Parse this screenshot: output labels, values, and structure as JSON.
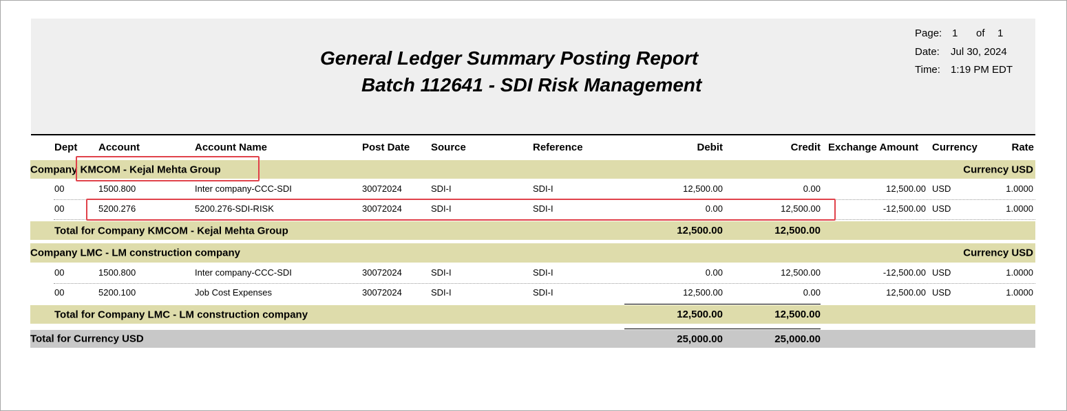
{
  "report": {
    "title": "General Ledger Summary Posting Report",
    "subtitle": "Batch 112641 - SDI Risk Management",
    "page_label": "Page:",
    "page_num": "1",
    "of_label": "of",
    "page_total": "1",
    "date_label": "Date:",
    "date_value": "Jul 30, 2024",
    "time_label": "Time:",
    "time_value": "1:19 PM EDT"
  },
  "columns": {
    "dept": "Dept",
    "account": "Account",
    "account_name": "Account Name",
    "post_date": "Post Date",
    "source": "Source",
    "reference": "Reference",
    "debit": "Debit",
    "credit": "Credit",
    "exchange_amount": "Exchange Amount",
    "currency": "Currency",
    "rate": "Rate"
  },
  "groups": [
    {
      "label": "Company KMCOM - Kejal Mehta Group",
      "currency_label": "Currency USD",
      "rows": [
        {
          "dept": "00",
          "account": "1500.800",
          "account_name": "Inter company-CCC-SDI",
          "post_date": "30072024",
          "source": "SDI-I",
          "reference": "SDI-I",
          "debit": "12,500.00",
          "credit": "0.00",
          "exchange_amount": "12,500.00",
          "currency": "USD",
          "rate": "1.0000"
        },
        {
          "dept": "00",
          "account": "5200.276",
          "account_name": "5200.276-SDI-RISK",
          "post_date": "30072024",
          "source": "SDI-I",
          "reference": "SDI-I",
          "debit": "0.00",
          "credit": "12,500.00",
          "exchange_amount": "-12,500.00",
          "currency": "USD",
          "rate": "1.0000"
        }
      ],
      "total_label": "Total for Company KMCOM - Kejal Mehta Group",
      "total_debit": "12,500.00",
      "total_credit": "12,500.00"
    },
    {
      "label": "Company LMC - LM construction company",
      "currency_label": "Currency USD",
      "rows": [
        {
          "dept": "00",
          "account": "1500.800",
          "account_name": "Inter company-CCC-SDI",
          "post_date": "30072024",
          "source": "SDI-I",
          "reference": "SDI-I",
          "debit": "0.00",
          "credit": "12,500.00",
          "exchange_amount": "-12,500.00",
          "currency": "USD",
          "rate": "1.0000"
        },
        {
          "dept": "00",
          "account": "5200.100",
          "account_name": "Job Cost Expenses",
          "post_date": "30072024",
          "source": "SDI-I",
          "reference": "SDI-I",
          "debit": "12,500.00",
          "credit": "0.00",
          "exchange_amount": "12,500.00",
          "currency": "USD",
          "rate": "1.0000"
        }
      ],
      "total_label": "Total for Company LMC - LM construction company",
      "total_debit": "12,500.00",
      "total_credit": "12,500.00"
    }
  ],
  "grand_total": {
    "label": "Total for Currency USD",
    "debit": "25,000.00",
    "credit": "25,000.00"
  },
  "highlight_color": "#e0414a"
}
